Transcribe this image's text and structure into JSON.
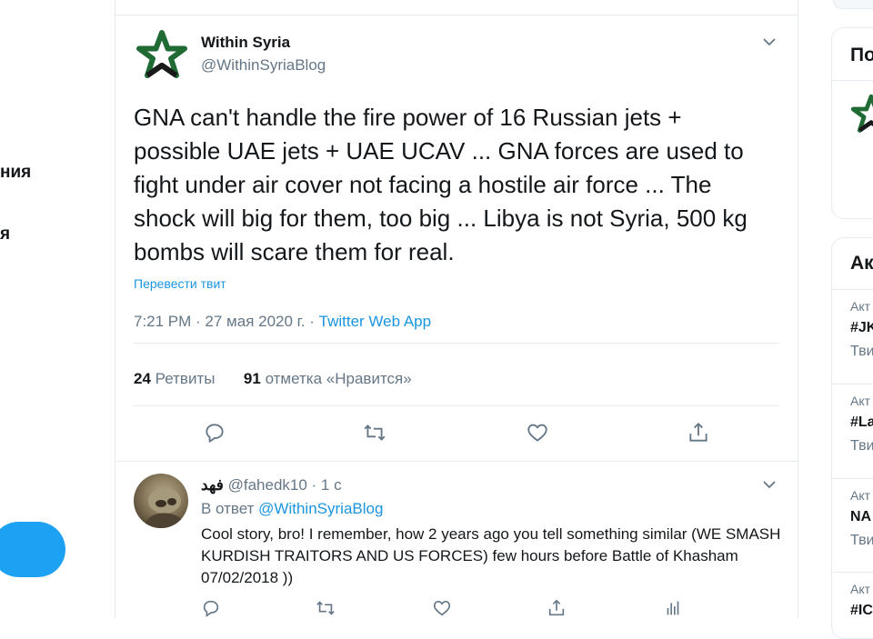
{
  "left_nav": {
    "frag1": "ния",
    "frag2": "я"
  },
  "tweet": {
    "author_name": "Within Syria",
    "author_handle": "@WithinSyriaBlog",
    "text": "GNA can't handle the fire power of 16 Russian jets + possible UAE jets + UAE UCAV ... GNA forces are used to fight under air cover not facing a hostile air force ... The shock will big for them, too big ... Libya is not Syria, 500 kg bombs will scare them for real.",
    "translate_label": "Перевести твит",
    "time": "7:21 PM · 27 мая 2020 г. · ",
    "source": "Twitter Web App",
    "retweets_count": "24",
    "retweets_label": " Ретвиты",
    "likes_count": "91",
    "likes_label": " отметка «Нравится»",
    "icons": [
      "reply-icon",
      "retweet-icon",
      "like-icon",
      "share-icon",
      "caret-down-icon"
    ]
  },
  "reply": {
    "name": "فهد",
    "handle": " @fahedk10 · 1 с",
    "replying_prefix": "В ответ ",
    "replying_to": "@WithinSyriaBlog",
    "text": "Cool story, bro! I remember, how 2 years ago you tell something similar (WE SMASH KURDISH TRAITORS AND US FORCES) few hours  before Battle of Khasham 07/02/2018 ))"
  },
  "right_sidebar": {
    "panel1_title": "По",
    "panel2_title": "Ак",
    "trends": [
      {
        "category": "Акт",
        "name": "#JK",
        "count": "Тви"
      },
      {
        "category": "Акт",
        "name": "#La",
        "count": "Тви"
      },
      {
        "category": "Акт",
        "name": "NA",
        "count": "Тви"
      },
      {
        "category": "Акт",
        "name": "#IC",
        "count": ""
      }
    ]
  },
  "colors": {
    "accent": "#1da1f2",
    "link": "#1b95e0",
    "muted": "#657786",
    "text": "#14171a",
    "border": "#e6ecf0"
  }
}
